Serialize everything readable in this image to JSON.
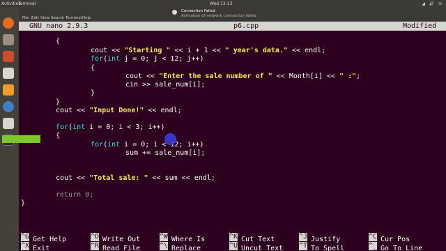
{
  "topbar": {
    "activities": "Activities",
    "app_name": "Terminal",
    "clock": "Wed 13:13",
    "tray": "◢ 🔊 ⏻"
  },
  "menubar": {
    "items": [
      "File",
      "Edit",
      "View",
      "Search",
      "Terminal",
      "Help"
    ]
  },
  "notification": {
    "title": "Connection Failed",
    "body": "Activation of network connection failed"
  },
  "nano": {
    "version": "GNU nano 2.9.3",
    "filename": "p6.cpp",
    "status": "Modified"
  },
  "code": {
    "l1": "{",
    "l2_a": "cout << ",
    "l2_s1": "\"Starting \"",
    "l2_b": " << i + 1 << ",
    "l2_s2": "\" year's data.\"",
    "l2_c": " << endl;",
    "l3_for": "for",
    "l3_a": "(",
    "l3_int": "int",
    "l3_b": " j = 0; j < 12; j++)",
    "l4": "{",
    "l5_a": "cout << ",
    "l5_s1": "\"Enter the sale number of \"",
    "l5_b": " << Month[i] << ",
    "l5_s2": "\" :\"",
    "l5_c": ";",
    "l6": "cin >> sale_num[i];",
    "l7": "}",
    "l8": "}",
    "l9_a": "cout << ",
    "l9_s": "\"Input Done!\"",
    "l9_b": " << endl;",
    "l10_for": "for",
    "l10_a": "(",
    "l10_int": "int",
    "l10_b": " i = 0; i < 3; i++)",
    "l11": "{",
    "l12_for": "for",
    "l12_a": "(",
    "l12_int": "int",
    "l12_b": " i = 0; i < 12; i++)",
    "l13": "sum += sale_num[i];",
    "l14_a": "cout << ",
    "l14_s": "\"Total sale: \"",
    "l14_b": " << sum << endl;",
    "l15": "return 0;",
    "l16": "}"
  },
  "shortcuts": [
    {
      "key": "^G",
      "label": "Get Help"
    },
    {
      "key": "^O",
      "label": "Write Out"
    },
    {
      "key": "^W",
      "label": "Where Is"
    },
    {
      "key": "^K",
      "label": "Cut Text"
    },
    {
      "key": "^J",
      "label": "Justify"
    },
    {
      "key": "^C",
      "label": "Cur Pos"
    },
    {
      "key": "^X",
      "label": "Exit"
    },
    {
      "key": "^R",
      "label": "Read File"
    },
    {
      "key": "^\\",
      "label": "Replace"
    },
    {
      "key": "^U",
      "label": "Uncut Text"
    },
    {
      "key": "^T",
      "label": "To Spell"
    },
    {
      "key": "^_",
      "label": "Go To Line"
    }
  ],
  "colors": {
    "background": "#2c001e",
    "keyword": "#34e2e2",
    "string": "#fce94f",
    "cursor_highlight": "#7ec82b",
    "mouse_pointer": "#3a3bd9"
  }
}
